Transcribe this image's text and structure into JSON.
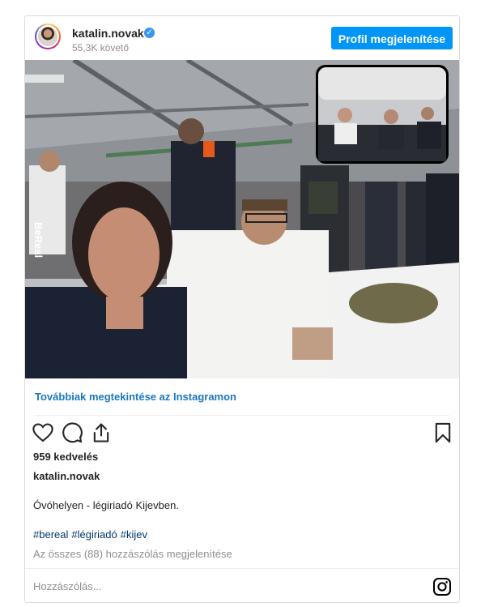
{
  "header": {
    "username": "katalin.novak",
    "verified_icon": "verified-badge-icon",
    "followers": "55,3K követő",
    "profile_button": "Profil megjelenítése"
  },
  "photo": {
    "watermark": "BeReal"
  },
  "view_more": "Továbbiak megtekintése az Instagramon",
  "actions": {
    "like_icon": "heart-icon",
    "comment_icon": "comment-icon",
    "share_icon": "share-icon",
    "save_icon": "bookmark-icon"
  },
  "likes": "959 kedvelés",
  "caption": {
    "username": "katalin.novak",
    "text": "Óvóhelyen - légiriadó Kijevben."
  },
  "hashtags": [
    "#bereal",
    "#légiriadó",
    "#kijev"
  ],
  "comments_link": "Az összes (88) hozzászólás megjelenítése",
  "comment_box": {
    "placeholder": "Hozzászólás..."
  },
  "colors": {
    "button": "#0095f6",
    "link": "#1a78c2",
    "hashtag": "#00376b",
    "muted": "#8e8e8e",
    "verified": "#3897f0"
  }
}
